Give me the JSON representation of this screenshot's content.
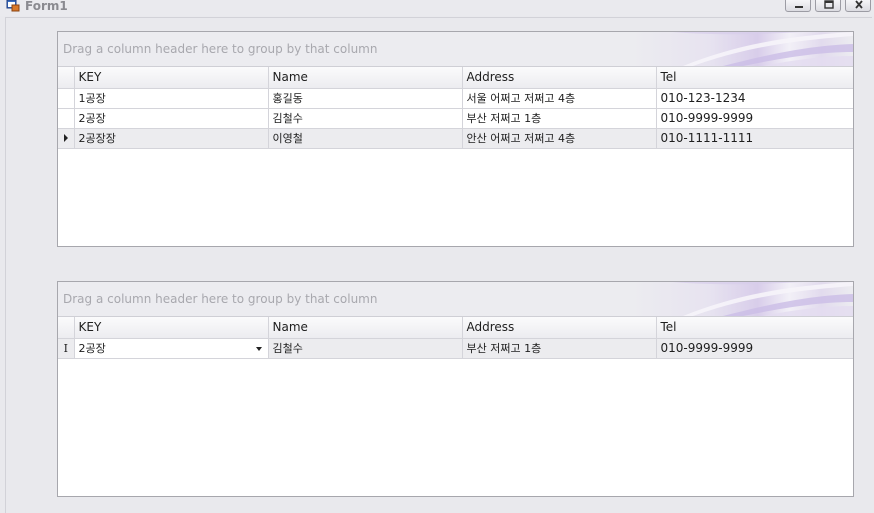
{
  "window": {
    "title": "Form1"
  },
  "grid1": {
    "group_hint": "Drag a column header here to group by that column",
    "columns": [
      "KEY",
      "Name",
      "Address",
      "Tel"
    ],
    "rows": [
      [
        "1공장",
        "홍길동",
        "서울 어쩌고 저쩌고 4층",
        "010-123-1234"
      ],
      [
        "2공장",
        "김철수",
        "부산 저쩌고 1층",
        "010-9999-9999"
      ],
      [
        "2공장장",
        "이영철",
        "안산 어쩌고 저쩌고 4층",
        "010-1111-1111"
      ]
    ]
  },
  "grid2": {
    "group_hint": "Drag a column header here to group by that column",
    "columns": [
      "KEY",
      "Name",
      "Address",
      "Tel"
    ],
    "rows": [
      [
        "2공장",
        "김철수",
        "부산 저쩌고 1층",
        "010-9999-9999"
      ]
    ]
  }
}
